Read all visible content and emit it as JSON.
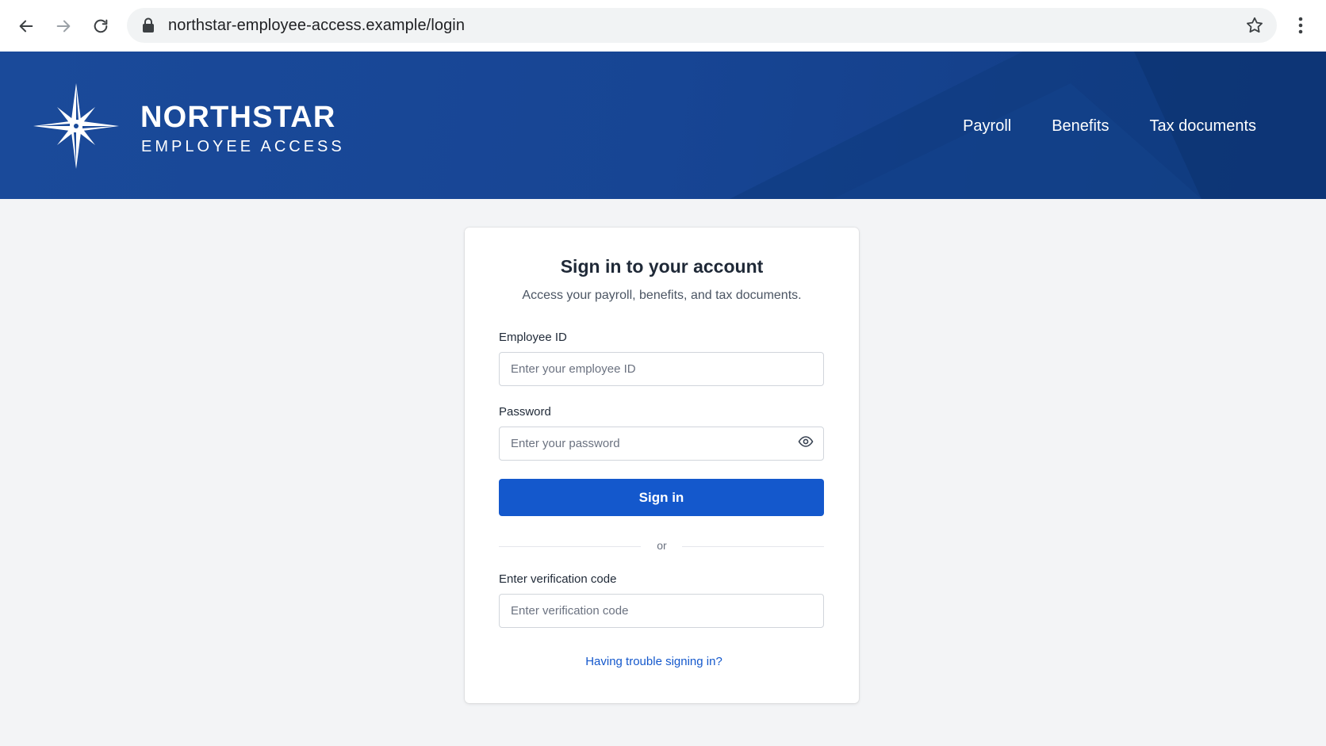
{
  "browser": {
    "url": "northstar-employee-access.example/login"
  },
  "header": {
    "brand_name": "NORTHSTAR",
    "brand_sub": "EMPLOYEE ACCESS",
    "nav": [
      {
        "label": "Payroll"
      },
      {
        "label": "Benefits"
      },
      {
        "label": "Tax documents"
      }
    ]
  },
  "login": {
    "title": "Sign in to your account",
    "subtitle": "Access your payroll, benefits, and tax documents.",
    "employee_id_label": "Employee ID",
    "employee_id_placeholder": "Enter your employee ID",
    "employee_id_value": "",
    "password_label": "Password",
    "password_placeholder": "Enter your password",
    "password_value": "",
    "signin_label": "Sign in",
    "divider_text": "or",
    "verification_label": "Enter verification code",
    "verification_placeholder": "Enter verification code",
    "verification_value": "",
    "help_link": "Having trouble signing in?"
  },
  "colors": {
    "header_blue": "#174594",
    "primary_button": "#1458cc",
    "link": "#1458cc",
    "page_background": "#f3f4f6"
  },
  "icons": [
    "back-arrow-icon",
    "forward-arrow-icon",
    "reload-icon",
    "lock-icon",
    "star-icon",
    "kebab-menu-icon",
    "compass-star-logo-icon",
    "eye-icon"
  ]
}
